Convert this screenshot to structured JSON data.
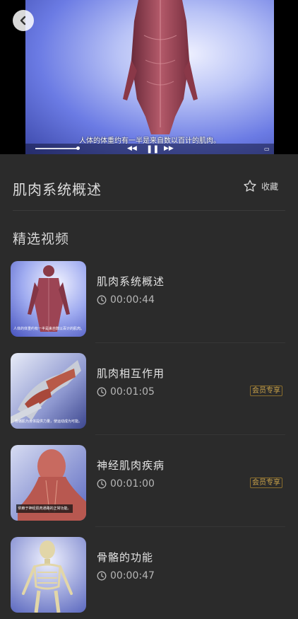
{
  "player": {
    "subtitle": "人体的体重约有一半是来自数以百计的肌肉。",
    "progress": 0.2
  },
  "header": {
    "title": "肌肉系统概述",
    "favorite_label": "收藏"
  },
  "section": {
    "title": "精选视频"
  },
  "videos": [
    {
      "title": "肌肉系统概述",
      "duration": "00:00:44",
      "badge": "",
      "thumb_caption": "人体的体重约有一半是来自数以百计的肌肉。"
    },
    {
      "title": "肌肉相互作用",
      "duration": "00:01:05",
      "badge": "会员专享",
      "thumb_caption": "骨骼肌为身体提供力量，使运动成为可能。"
    },
    {
      "title": "神经肌肉疾病",
      "duration": "00:01:00",
      "badge": "会员专享",
      "thumb_caption": "依赖于神经肌肉通路的正常功能。"
    },
    {
      "title": "骨骼的功能",
      "duration": "00:00:47",
      "badge": ""
    }
  ],
  "colors": {
    "background": "#2b2b2b",
    "badge_gold": "#c9a24a"
  }
}
